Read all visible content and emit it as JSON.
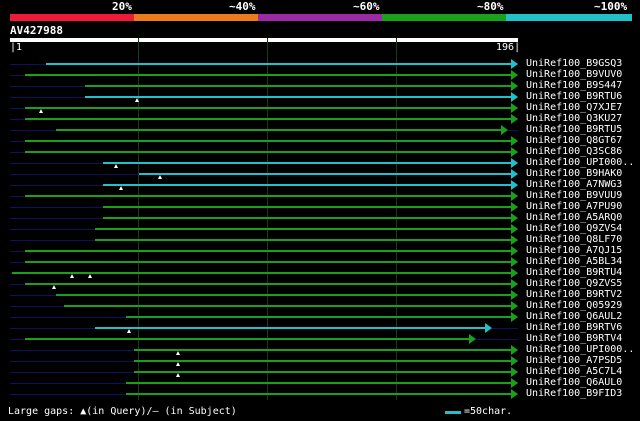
{
  "header": {
    "ticks": [
      "20%",
      "~40%",
      "~60%",
      "~80%",
      "~100%"
    ],
    "colors": [
      "#ee1a3a",
      "#ee7a1e",
      "#9a2aa6",
      "#1aa01a",
      "#22c0c8"
    ]
  },
  "query": {
    "name": "AV427988",
    "start": "1",
    "end": "196"
  },
  "hits": [
    {
      "label": "UniRef100_B9GSQ3",
      "color": "#22c0c8",
      "start": 14,
      "end": 196,
      "gap_from": 14,
      "gap_to": 28
    },
    {
      "label": "UniRef100_B9VUV0",
      "color": "#1aa01a",
      "start": 6,
      "end": 196
    },
    {
      "label": "UniRef100_B9S447",
      "color": "#1aa01a",
      "start": 29,
      "end": 196
    },
    {
      "label": "UniRef100_B9RTU6",
      "color": "#22c0c8",
      "start": 29,
      "end": 196,
      "marks": [
        49
      ]
    },
    {
      "label": "UniRef100_Q7XJE7",
      "color": "#1aa01a",
      "start": 6,
      "end": 196,
      "marks": [
        12
      ]
    },
    {
      "label": "UniRef100_Q3KU27",
      "color": "#1aa01a",
      "start": 6,
      "end": 196
    },
    {
      "label": "UniRef100_B9RTU5",
      "color": "#1aa01a",
      "start": 18,
      "end": 192
    },
    {
      "label": "UniRef100_Q8GT67",
      "color": "#1aa01a",
      "start": 6,
      "end": 196
    },
    {
      "label": "UniRef100_Q3SC86",
      "color": "#1aa01a",
      "start": 6,
      "end": 196
    },
    {
      "label": "UniRef100_UPI000..",
      "color": "#22c0c8",
      "start": 36,
      "end": 196,
      "marks": [
        41
      ]
    },
    {
      "label": "UniRef100_B9HAK0",
      "color": "#22c0c8",
      "start": 50,
      "end": 196,
      "marks": [
        58
      ]
    },
    {
      "label": "UniRef100_A7NWG3",
      "color": "#22c0c8",
      "start": 36,
      "end": 196,
      "marks": [
        43
      ]
    },
    {
      "label": "UniRef100_B9VUU9",
      "color": "#1aa01a",
      "start": 6,
      "end": 196
    },
    {
      "label": "UniRef100_A7PU90",
      "color": "#1aa01a",
      "start": 36,
      "end": 196
    },
    {
      "label": "UniRef100_A5ARQ0",
      "color": "#1aa01a",
      "start": 36,
      "end": 196
    },
    {
      "label": "UniRef100_Q9ZVS4",
      "color": "#1aa01a",
      "start": 33,
      "end": 196
    },
    {
      "label": "UniRef100_Q8LF70",
      "color": "#1aa01a",
      "start": 33,
      "end": 196
    },
    {
      "label": "UniRef100_A7QJ15",
      "color": "#1aa01a",
      "start": 6,
      "end": 196
    },
    {
      "label": "UniRef100_A5BL34",
      "color": "#1aa01a",
      "start": 6,
      "end": 196
    },
    {
      "label": "UniRef100_B9RTU4",
      "color": "#1aa01a",
      "start": 1,
      "end": 196,
      "marks": [
        24,
        31
      ]
    },
    {
      "label": "UniRef100_Q9ZVS5",
      "color": "#1aa01a",
      "start": 6,
      "end": 196,
      "marks": [
        17
      ]
    },
    {
      "label": "UniRef100_B9RTV2",
      "color": "#1aa01a",
      "start": 18,
      "end": 196
    },
    {
      "label": "UniRef100_Q05929",
      "color": "#1aa01a",
      "start": 21,
      "end": 196
    },
    {
      "label": "UniRef100_Q6AUL2",
      "color": "#1aa01a",
      "start": 45,
      "end": 196
    },
    {
      "label": "UniRef100_B9RTV6",
      "color": "#22c0c8",
      "start": 33,
      "end": 186,
      "marks": [
        46
      ]
    },
    {
      "label": "UniRef100_B9RTV4",
      "color": "#1aa01a",
      "start": 6,
      "end": 180
    },
    {
      "label": "UniRef100_UPI000..",
      "color": "#1aa01a",
      "start": 48,
      "end": 196,
      "marks": [
        65
      ]
    },
    {
      "label": "UniRef100_A7PSD5",
      "color": "#1aa01a",
      "start": 48,
      "end": 196,
      "marks": [
        65
      ]
    },
    {
      "label": "UniRef100_A5C7L4",
      "color": "#1aa01a",
      "start": 48,
      "end": 196,
      "marks": [
        65
      ]
    },
    {
      "label": "UniRef100_Q6AUL0",
      "color": "#1aa01a",
      "start": 45,
      "end": 196
    },
    {
      "label": "UniRef100_B9FID3",
      "color": "#1aa01a",
      "start": 45,
      "end": 196
    }
  ],
  "legend": {
    "gaps_text": "Large gaps: ▲(in Query)/— (in Subject)",
    "scale_text": "=50char."
  }
}
